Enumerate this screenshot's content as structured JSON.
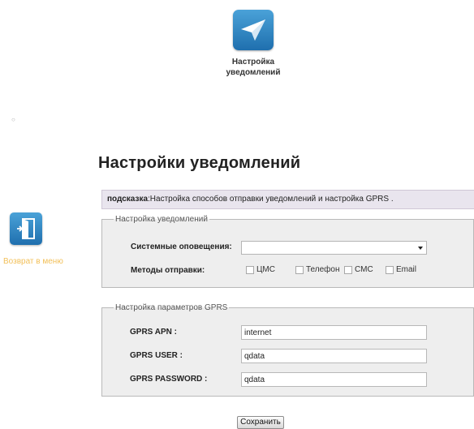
{
  "header": {
    "icon": "paper-plane-icon",
    "caption_line1": "Настройка",
    "caption_line2": "уведомлений",
    "dot": "○"
  },
  "page": {
    "title": "Настройки уведомлений"
  },
  "sidebar": {
    "back_icon": "door-exit-icon",
    "back_label": "Возврат в меню"
  },
  "hint": {
    "label": "подсказка",
    "text": ":Настройка способов отправки уведомлений и настройка GPRS ."
  },
  "notifications": {
    "legend": "Настройка уведомлений",
    "system_label": "Системные оповещения:",
    "system_value": "",
    "methods_label": "Методы отправки:",
    "methods": [
      {
        "label": "ЦМС",
        "checked": false
      },
      {
        "label": "Телефон",
        "checked": false
      },
      {
        "label": "СМС",
        "checked": false
      },
      {
        "label": "Email",
        "checked": false
      }
    ]
  },
  "gprs": {
    "legend": "Настройка параметров GPRS",
    "apn_label": "GPRS APN :",
    "apn_value": "internet",
    "user_label": "GPRS USER :",
    "user_value": "qdata",
    "password_label": "GPRS PASSWORD :",
    "password_value": "qdata"
  },
  "actions": {
    "save_label": "Сохранить"
  },
  "colors": {
    "icon_blue": "#2f86c4",
    "hint_bg": "#e9e5ee",
    "panel_bg": "#eeeeee",
    "back_label": "#f2c05a"
  }
}
